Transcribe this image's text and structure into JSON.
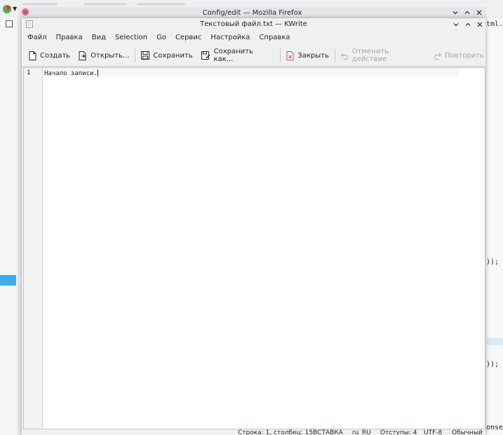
{
  "firefox_window": {
    "title": "Config/edit — Mozilla Firefox"
  },
  "kwrite": {
    "title": "Текстовый файл.txt — KWrite",
    "menu": [
      "Файл",
      "Правка",
      "Вид",
      "Selection",
      "Go",
      "Сервис",
      "Настройка",
      "Справка"
    ],
    "toolbar": {
      "new": "Создать",
      "open": "Открыть...",
      "save": "Сохранить",
      "save_as": "Сохранить как...",
      "close": "Закрыть",
      "undo": "Отменить действие",
      "redo": "Повторить"
    },
    "editor": {
      "line_number": "1",
      "line_text": "Начало записи."
    },
    "status": {
      "position": "Строка: 1, столбец: 15",
      "mode": "ВСТАВКА",
      "language": "ru_RU",
      "indent": "Отступы: 4",
      "encoding": "UTF-8",
      "syntax": "Обычный"
    }
  },
  "background": {
    "right_code_1": "));",
    "right_code_2": "));",
    "right_code_3": "onse",
    "right_tab": "tml.tx"
  },
  "colors": {
    "selection": "#3daee9",
    "window_bg": "#eff0f1",
    "text": "#232629",
    "close_icon_red": "#da4453"
  }
}
